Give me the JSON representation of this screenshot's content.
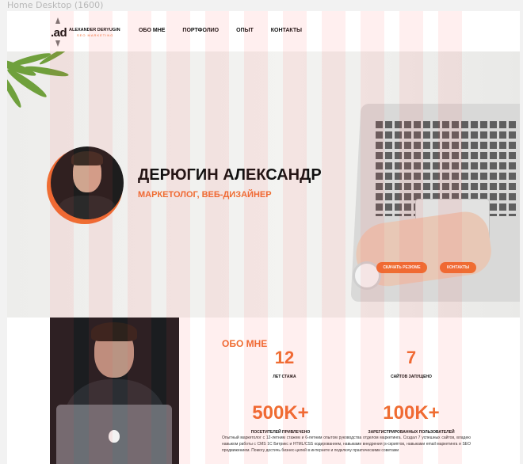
{
  "frame_label": "Home Desktop (1600)",
  "header": {
    "logo_mark": ".ad",
    "logo_name": "ALEXANDER DERYUGIN",
    "logo_sub": "SEO MARKETING",
    "nav": [
      "ОБО МНЕ",
      "ПОРТФОЛИО",
      "ОПЫТ",
      "КОНТАКТЫ"
    ]
  },
  "hero": {
    "name": "ДЕРЮГИН АЛЕКСАНДР",
    "role": "МАРКЕТОЛОГ, ВЕБ-ДИЗАЙНЕР",
    "btn_resume": "СКАЧАТЬ РЕЗЮМЕ",
    "btn_contacts": "КОНТАКТЫ"
  },
  "about": {
    "title": "ОБО МНЕ",
    "stats": [
      {
        "value": "12",
        "label": "ЛЕТ СТАЖА"
      },
      {
        "value": "7",
        "label": "САЙТОВ ЗАПУЩЕНО"
      },
      {
        "value": "500K+",
        "label": "ПОСЕТИТЕЛЕЙ ПРИВЛЕЧЕНО"
      },
      {
        "value": "100K+",
        "label": "ЗАРЕГИСТРИРОВАННЫХ ПОЛЬЗОВАТЕЛЕЙ"
      }
    ],
    "text": "Опытный маркетолог с 12-летним стажем и 6-летним опытом руководства отделом маркетинга. Создал 7 успешных сайтов, владею навыком работы с CMS 1С Битрикс и HTML/CSS кодированием, навыками внедрения js-скриптов, навыками email маркетинга и SEO продвижением. Помогу достичь бизнес-целей в интернете и подключу практическими советами"
  },
  "colors": {
    "accent": "#ef6d32",
    "grid_overlay": "#ff4848"
  }
}
